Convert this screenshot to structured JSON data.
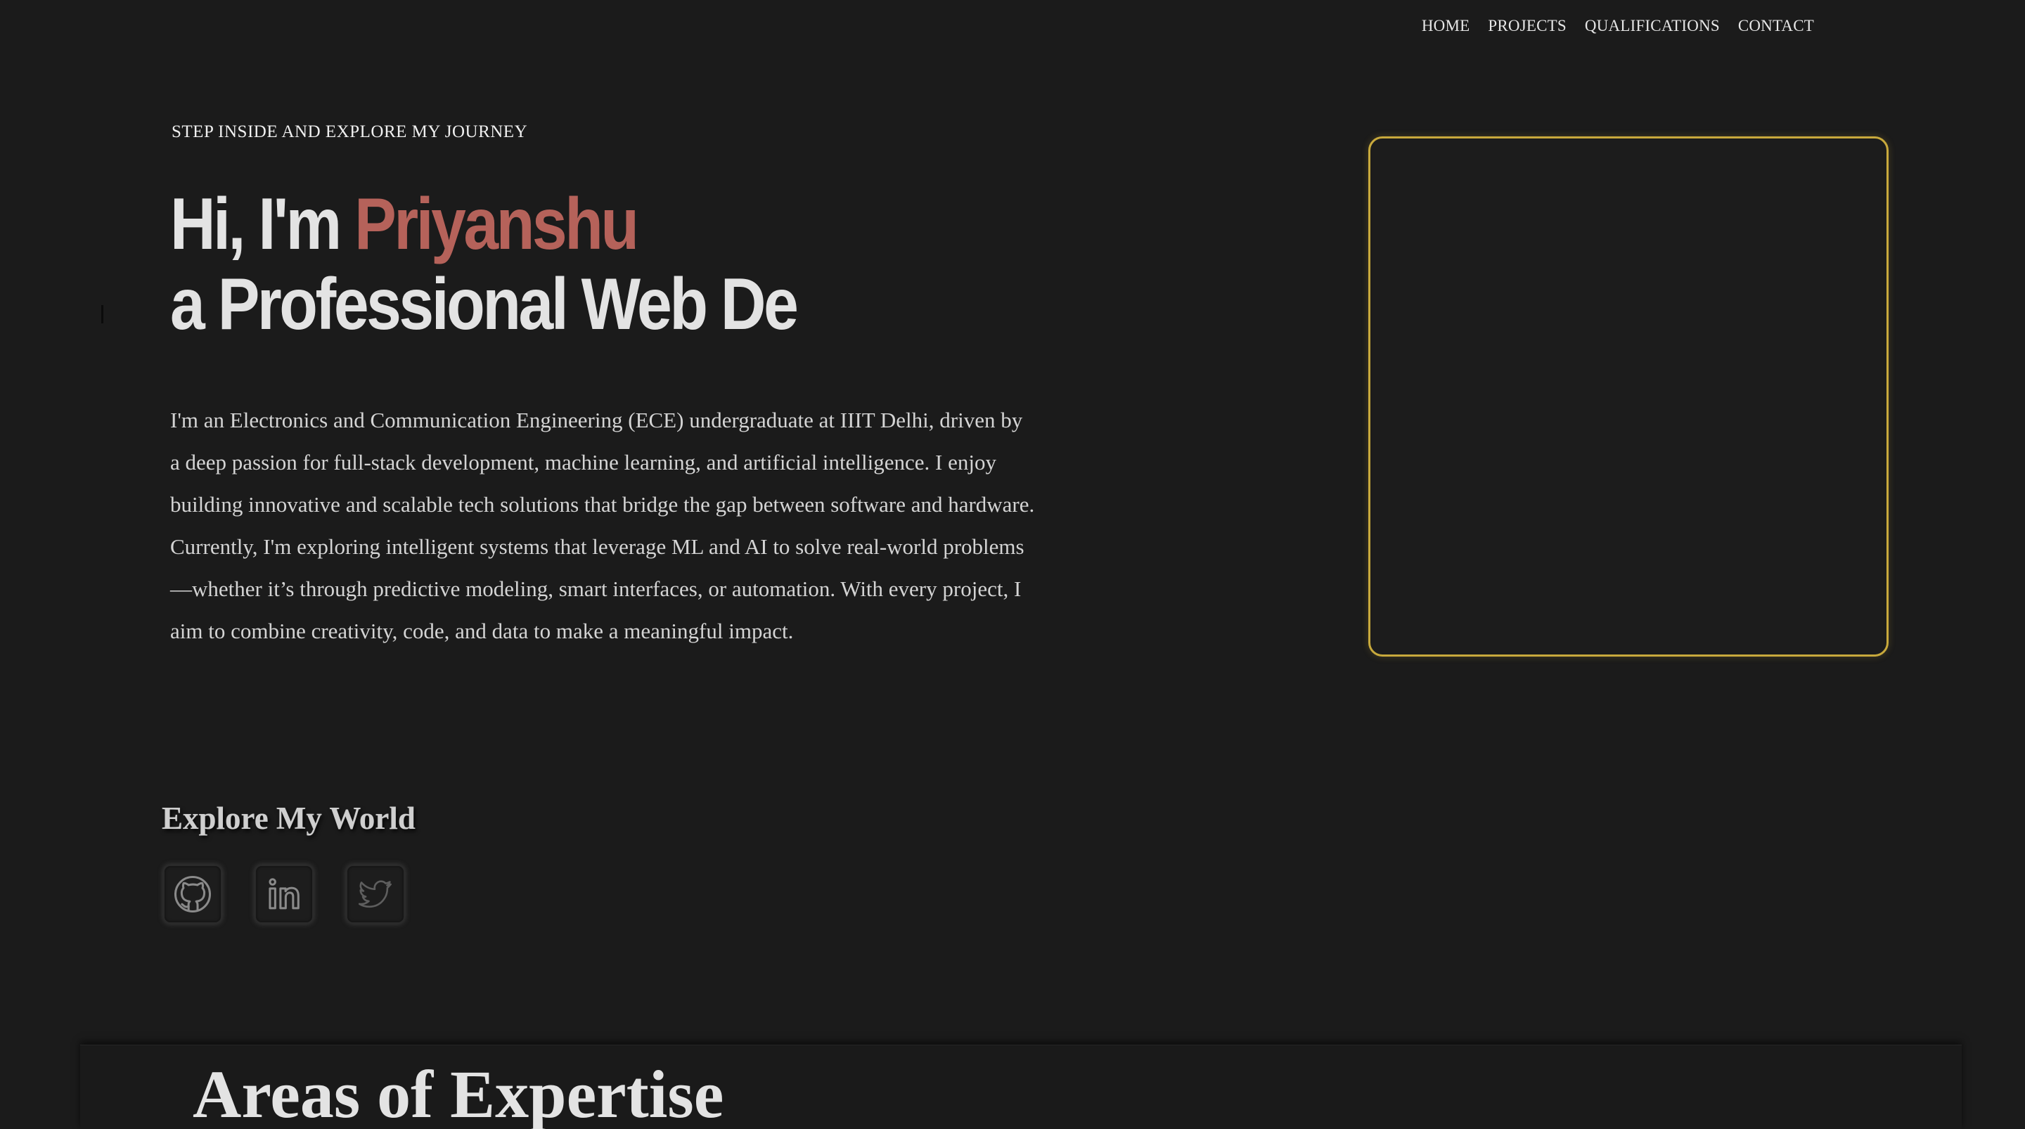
{
  "nav": {
    "items": [
      {
        "label": "HOME"
      },
      {
        "label": "PROJECTS"
      },
      {
        "label": "QUALIFICATIONS"
      },
      {
        "label": "CONTACT"
      }
    ]
  },
  "hero": {
    "eyebrow": "STEP INSIDE AND EXPLORE MY JOURNEY",
    "greeting": "Hi, I'm ",
    "name": "Priyanshu",
    "typed_line": "a Professional Web De",
    "bio": "I'm an Electronics and Communication Engineering (ECE) undergraduate at IIIT Delhi, driven by a deep passion for full-stack development, machine learning, and artificial intelligence. I enjoy building innovative and scalable tech solutions that bridge the gap between software and hardware. Currently, I'm exploring intelligent systems that leverage ML and AI to solve real-world problems—whether it’s through predictive modeling, smart interfaces, or automation. With every project, I aim to combine creativity, code, and data to make a meaningful impact."
  },
  "socials": {
    "title": "Explore My World",
    "links": [
      {
        "icon": "github-icon"
      },
      {
        "icon": "linkedin-icon"
      },
      {
        "icon": "twitter-icon"
      }
    ]
  },
  "next_section": {
    "title_partial": "Areas of Expertise"
  },
  "colors": {
    "background": "#1b1b1b",
    "accent_name": "#b5625a",
    "frame_border": "#c8a93c"
  }
}
